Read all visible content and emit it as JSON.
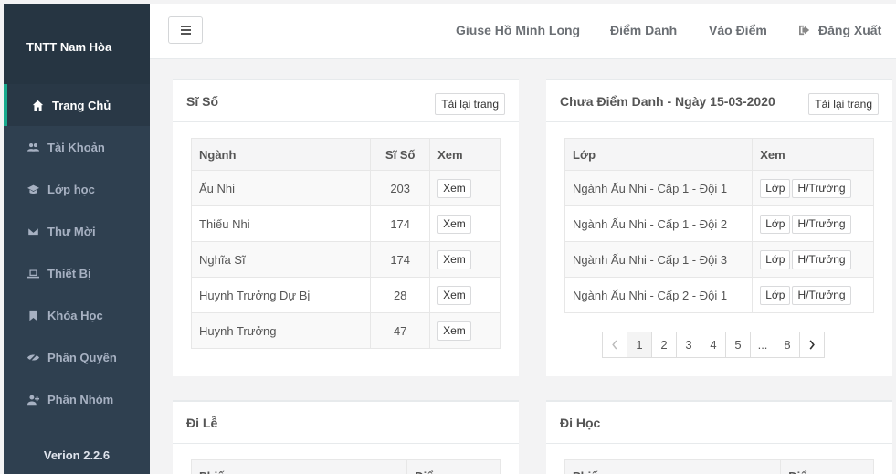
{
  "sidebar": {
    "brand": "TNTT Nam Hòa",
    "items": [
      {
        "label": "Trang Chủ",
        "icon": "home-icon",
        "active": true
      },
      {
        "label": "Tài Khoản",
        "icon": "users-icon"
      },
      {
        "label": "Lớp học",
        "icon": "graduation-cap-icon"
      },
      {
        "label": "Thư Mời",
        "icon": "envelope-icon"
      },
      {
        "label": "Thiết Bị",
        "icon": "laptop-icon"
      },
      {
        "label": "Khóa Học",
        "icon": "bookmark-icon"
      },
      {
        "label": "Phân Quyền",
        "icon": "eye-slash-icon"
      },
      {
        "label": "Phân Nhóm",
        "icon": "user-plus-icon"
      }
    ],
    "version": "Verion 2.2.6"
  },
  "topbar": {
    "user_name": "Giuse Hồ Minh Long",
    "attendance": "Điểm Danh",
    "grades": "Vào Điểm",
    "logout": "Đăng Xuất"
  },
  "panel_si_so": {
    "title": "Sĩ Số",
    "reload": "Tải lại trang",
    "headers": [
      "Ngành",
      "Sĩ Số",
      "Xem"
    ],
    "rows": [
      {
        "nganh": "Ấu Nhi",
        "count": "203",
        "view": "Xem"
      },
      {
        "nganh": "Thiếu Nhi",
        "count": "174",
        "view": "Xem"
      },
      {
        "nganh": "Nghĩa Sĩ",
        "count": "174",
        "view": "Xem"
      },
      {
        "nganh": "Huynh Trưởng Dự Bị",
        "count": "28",
        "view": "Xem"
      },
      {
        "nganh": "Huynh Trưởng",
        "count": "47",
        "view": "Xem"
      }
    ]
  },
  "panel_chua_diem_danh": {
    "title": "Chưa Điểm Danh - Ngày 15-03-2020",
    "reload": "Tải lại trang",
    "headers": [
      "Lớp",
      "Xem"
    ],
    "rows": [
      {
        "lop": "Ngành Ấu Nhi - Cấp 1 - Đội 1",
        "btn1": "Lớp",
        "btn2": "H/Trưởng"
      },
      {
        "lop": "Ngành Ấu Nhi - Cấp 1 - Đội 2",
        "btn1": "Lớp",
        "btn2": "H/Trưởng"
      },
      {
        "lop": "Ngành Ấu Nhi - Cấp 1 - Đội 3",
        "btn1": "Lớp",
        "btn2": "H/Trưởng"
      },
      {
        "lop": "Ngành Ấu Nhi - Cấp 2 - Đội 1",
        "btn1": "Lớp",
        "btn2": "H/Trưởng"
      }
    ],
    "pagination": {
      "pages": [
        "1",
        "2",
        "3",
        "4",
        "5",
        "...",
        "8"
      ],
      "current": "1"
    }
  },
  "panel_di_le": {
    "title": "Đi Lễ",
    "headers": [
      "Phiếu",
      "Điểm"
    ]
  },
  "panel_di_hoc": {
    "title": "Đi Học",
    "headers": [
      "Phiếu",
      "Điểm"
    ]
  },
  "colors": {
    "sidebar_bg": "#2f4050",
    "accent": "#19aa8d"
  }
}
